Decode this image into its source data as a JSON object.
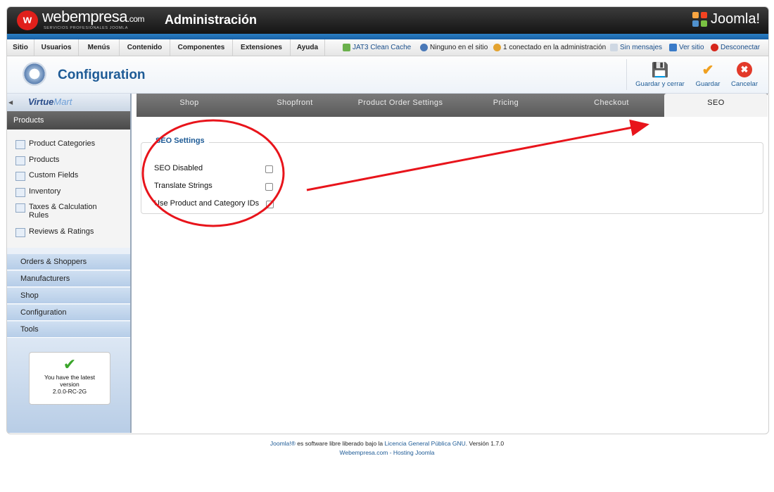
{
  "header": {
    "logo_mark": "w",
    "logo_name": "webempresa",
    "logo_domain": ".com",
    "logo_tagline": "SERVICIOS PROFESIONALES JOOMLA",
    "title": "Administración",
    "brand": "Joomla!"
  },
  "menu": {
    "items": [
      "Sitio",
      "Usuarios",
      "Menús",
      "Contenido",
      "Componentes",
      "Extensiones",
      "Ayuda"
    ],
    "status": {
      "cache": "JAT3 Clean Cache",
      "site_users": "Ninguno en el sitio",
      "admin_users": "1 conectado en la administración",
      "messages": "Sin mensajes",
      "view_site": "Ver sitio",
      "logout": "Desconectar"
    }
  },
  "toolbar": {
    "title": "Configuration",
    "save_close": "Guardar y cerrar",
    "save": "Guardar",
    "cancel": "Cancelar"
  },
  "sidebar": {
    "logo": "Virtue",
    "logo_accent": "Mart",
    "active_section": "Products",
    "product_items": [
      "Product Categories",
      "Products",
      "Custom Fields",
      "Inventory",
      "Taxes & Calculation Rules",
      "Reviews & Ratings"
    ],
    "groups": [
      "Orders & Shoppers",
      "Manufacturers",
      "Shop",
      "Configuration",
      "Tools"
    ],
    "version_line1": "You have the latest",
    "version_line2": "version",
    "version_number": "2.0.0-RC-2G"
  },
  "tabs": [
    "Shop",
    "Shopfront",
    "Product Order Settings",
    "Pricing",
    "Checkout",
    "SEO"
  ],
  "active_tab": "SEO",
  "seo": {
    "legend": "SEO Settings",
    "options": [
      {
        "label": "SEO Disabled",
        "checked": false
      },
      {
        "label": "Translate Strings",
        "checked": false
      },
      {
        "label": "Use Product and Category IDs",
        "checked": false
      }
    ]
  },
  "footer": {
    "brand": "Joomla!®",
    "text1": " es software libre liberado bajo la ",
    "license": "Licencia General Pública GNU",
    "text2": ".   Versión 1.7.0",
    "hosting": "Webempresa.com - Hosting Joomla"
  },
  "colors": {
    "annotation": "#e8141b",
    "accent": "#1e5b96"
  }
}
